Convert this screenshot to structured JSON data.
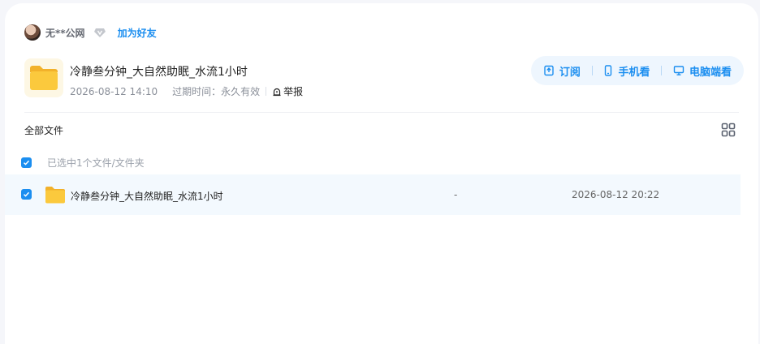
{
  "user": {
    "name": "无**公网",
    "add_friend_label": "加为好友"
  },
  "share": {
    "title": "冷静叁分钟_大自然助眠_水流1小时",
    "date": "2026-08-12 14:10",
    "expiry_label": "过期时间：",
    "expiry_value": "永久有效",
    "report_label": "举报"
  },
  "actions": {
    "subscribe": "订阅",
    "mobile": "手机看",
    "desktop": "电脑端看"
  },
  "breadcrumb": "全部文件",
  "selection_text": "已选中1个文件/文件夹",
  "files": [
    {
      "name": "冷静叁分钟_大自然助眠_水流1小时",
      "size": "-",
      "date": "2026-08-12 20:22",
      "checked": true
    }
  ],
  "colors": {
    "accent": "#1b8ef0",
    "row_highlight": "#f3f9fe",
    "folder": "#fbc93d"
  }
}
